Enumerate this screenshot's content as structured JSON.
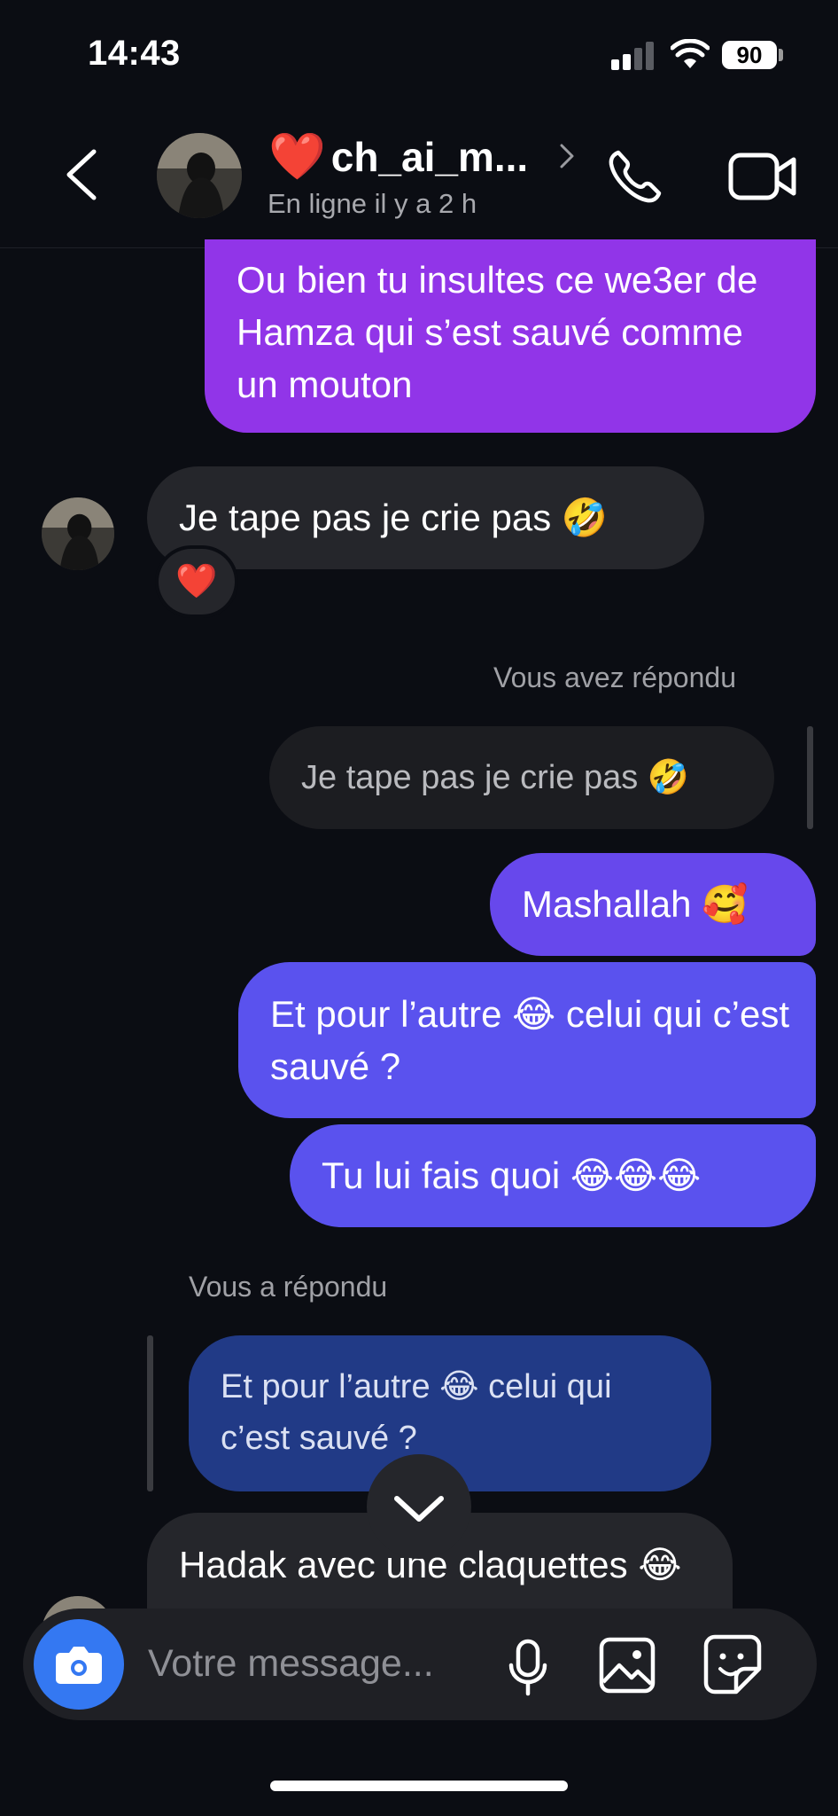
{
  "status_bar": {
    "time": "14:43",
    "battery": "90"
  },
  "header": {
    "heart": "❤️",
    "name": "ch_ai_m...",
    "status": "En ligne il y a 2 h",
    "icons": [
      "back-chevron",
      "avatar",
      "chevron-right",
      "phone-call",
      "video-call"
    ]
  },
  "messages": [
    {
      "id": "m1",
      "direction": "out",
      "text": "Ou bien tu insultes ce we3er de Hamza qui s’est sauvé comme un mouton"
    },
    {
      "id": "m2",
      "direction": "in",
      "text": "Je tape pas je crie pas 🤣",
      "reaction": "❤️"
    },
    {
      "id": "m3",
      "direction": "out",
      "reply_label": "Vous avez répondu",
      "reply_quote": "Je tape pas je crie pas 🤣",
      "text": "Mashallah 🥰"
    },
    {
      "id": "m4",
      "direction": "out",
      "text": "Et pour l’autre 😂 celui qui c’est sauvé ?"
    },
    {
      "id": "m5",
      "direction": "out",
      "text": "Tu lui fais quoi 😂😂😂"
    },
    {
      "id": "m6",
      "direction": "in",
      "reply_label": "Vous a répondu",
      "reply_quote": "Et pour l’autre 😂 celui qui c’est sauvé ?",
      "text": "Hadak avec une claquettes 😂"
    }
  ],
  "composer": {
    "placeholder": "Votre message...",
    "icons": [
      "camera",
      "microphone",
      "image-gallery",
      "sticker"
    ]
  },
  "colors": {
    "background": "#0b0d13",
    "outgoing_purple": "#9135e8",
    "outgoing_blue": "#5a52ee",
    "incoming_grey": "#25262b",
    "reply_navy": "#213a86",
    "camera_button": "#3478f2",
    "heart": "#e8112d"
  }
}
